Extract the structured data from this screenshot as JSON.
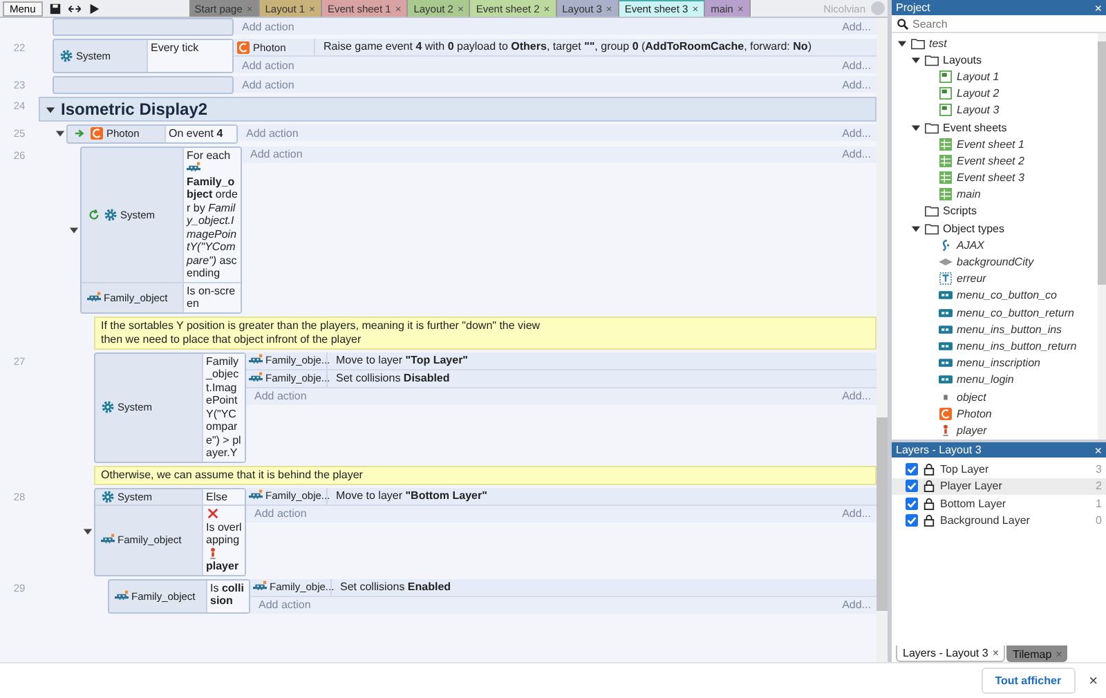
{
  "toolbar": {
    "menu": "Menu",
    "user": "Nicolvian"
  },
  "tabs": [
    {
      "label": "Start page",
      "close": "×",
      "selected": false,
      "color": "#8c8c8c"
    },
    {
      "label": "Layout 1",
      "close": "×",
      "selected": false,
      "color": "#c8b27a"
    },
    {
      "label": "Event sheet 1",
      "close": "×",
      "selected": false,
      "color": "#d9a3a3"
    },
    {
      "label": "Layout 2",
      "close": "×",
      "selected": false,
      "color": "#a9c98f"
    },
    {
      "label": "Event sheet 2",
      "close": "×",
      "selected": false,
      "color": "#bcd99e"
    },
    {
      "label": "Layout 3",
      "close": "×",
      "selected": false,
      "color": "#a9b0c8"
    },
    {
      "label": "Event sheet 3",
      "close": "×",
      "selected": true,
      "color": "#c9f3f5"
    },
    {
      "label": "main",
      "close": "×",
      "selected": false,
      "color": "#b8a0cc"
    }
  ],
  "events": [
    {
      "kind": "event",
      "add_action": "Add action",
      "add_more": "Add..."
    },
    {
      "kind": "event",
      "line": "22",
      "conditions": [
        {
          "object": "System",
          "kind": "system",
          "text": "Every tick"
        }
      ],
      "actions": [
        {
          "object": "Photon",
          "kind": "photon",
          "text": "Raise game event **4** with **0** payload to **Others**, target **\"\"**, group **0** (**AddToRoomCache**, forward: **No**)"
        }
      ],
      "add_action": "Add action",
      "add_more": "Add..."
    },
    {
      "kind": "event",
      "line": "23",
      "add_action": "Add action",
      "add_more": "Add..."
    },
    {
      "kind": "group",
      "line": "24",
      "title": "Isometric Display2",
      "expanded": true,
      "children": [
        {
          "kind": "event",
          "line": "25",
          "expanded": true,
          "conditions": [
            {
              "object": "Photon",
              "kind": "photon",
              "trigger": true,
              "text": "On event **4**"
            }
          ],
          "add_action": "Add action",
          "add_more": "Add...",
          "children": [
            {
              "kind": "event",
              "line": "26",
              "expanded": true,
              "conditions": [
                {
                  "object": "System",
                  "kind": "system",
                  "loop": true,
                  "parts": [
                    {
                      "kind": "text",
                      "text": "For each"
                    },
                    {
                      "kind": "sprite"
                    },
                    {
                      "kind": "text",
                      "text": "**Family_object** order by *Family_object.ImagePointY(\"YCompare\")* ascending"
                    }
                  ]
                },
                {
                  "object": "Family_object",
                  "kind": "sprite",
                  "text": "Is on-screen"
                }
              ],
              "add_action": "Add action",
              "add_more": "Add...",
              "children": [
                {
                  "kind": "comment",
                  "text": "If the sortables Y position is greater than the players, meaning it is further \"down\" the view\nthen we need to place that object infront of the player"
                },
                {
                  "kind": "event",
                  "line": "27",
                  "conditions": [
                    {
                      "object": "System",
                      "kind": "system",
                      "text": "Family_object.ImagePointY(\"YCompare\") > player.Y"
                    }
                  ],
                  "actions": [
                    {
                      "object": "Family_obje...",
                      "kind": "sprite",
                      "text": "Move to layer **\"Top Layer\"**"
                    },
                    {
                      "object": "Family_obje...",
                      "kind": "sprite",
                      "text": "Set collisions **Disabled**"
                    }
                  ],
                  "add_action": "Add action",
                  "add_more": "Add..."
                },
                {
                  "kind": "comment",
                  "text": "Otherwise, we can assume that it is behind the player"
                },
                {
                  "kind": "event",
                  "line": "28",
                  "expanded": true,
                  "conditions": [
                    {
                      "object": "System",
                      "kind": "system",
                      "text": "Else"
                    },
                    {
                      "object": "Family_object",
                      "kind": "sprite",
                      "inverted": true,
                      "parts": [
                        {
                          "kind": "text",
                          "text": "Is overlapping"
                        },
                        {
                          "kind": "player"
                        },
                        {
                          "kind": "text",
                          "text": "**player**"
                        }
                      ]
                    }
                  ],
                  "actions": [
                    {
                      "object": "Family_obje...",
                      "kind": "sprite",
                      "text": "Move to layer **\"Bottom Layer\"**"
                    }
                  ],
                  "add_action": "Add action",
                  "add_more": "Add...",
                  "children": [
                    {
                      "kind": "event",
                      "line": "29",
                      "conditions": [
                        {
                          "object": "Family_object",
                          "kind": "sprite",
                          "text": "Is **collision**"
                        }
                      ],
                      "actions": [
                        {
                          "object": "Family_obje...",
                          "kind": "sprite",
                          "text": "Set collisions **Enabled**"
                        }
                      ],
                      "add_action": "Add action",
                      "add_more": "Add..."
                    }
                  ]
                }
              ]
            }
          ]
        }
      ]
    }
  ],
  "project": {
    "title": "Project",
    "close": "×",
    "search": {
      "placeholder": "Search"
    },
    "tree": [
      {
        "label": "test",
        "kind": "project",
        "expanded": true,
        "children": [
          {
            "label": "Layouts",
            "kind": "folder",
            "expanded": true,
            "children": [
              {
                "label": "Layout 1",
                "kind": "layout"
              },
              {
                "label": "Layout 2",
                "kind": "layout"
              },
              {
                "label": "Layout 3",
                "kind": "layout"
              }
            ]
          },
          {
            "label": "Event sheets",
            "kind": "folder",
            "expanded": true,
            "children": [
              {
                "label": "Event sheet 1",
                "kind": "sheet"
              },
              {
                "label": "Event sheet 2",
                "kind": "sheet"
              },
              {
                "label": "Event sheet 3",
                "kind": "sheet"
              },
              {
                "label": "main",
                "kind": "sheet"
              }
            ]
          },
          {
            "label": "Scripts",
            "kind": "folder"
          },
          {
            "label": "Object types",
            "kind": "folder",
            "expanded": true,
            "children": [
              {
                "label": "AJAX",
                "kind": "ajax"
              },
              {
                "label": "backgroundCity",
                "kind": "tiled"
              },
              {
                "label": "erreur",
                "kind": "text"
              },
              {
                "label": "menu_co_button_co",
                "kind": "button"
              },
              {
                "label": "menu_co_button_return",
                "kind": "button"
              },
              {
                "label": "menu_ins_button_ins",
                "kind": "button"
              },
              {
                "label": "menu_ins_button_return",
                "kind": "button"
              },
              {
                "label": "menu_inscription",
                "kind": "button"
              },
              {
                "label": "menu_login",
                "kind": "button"
              },
              {
                "label": "object",
                "kind": "object"
              },
              {
                "label": "Photon",
                "kind": "photon"
              },
              {
                "label": "player",
                "kind": "player"
              }
            ]
          }
        ]
      }
    ]
  },
  "layers": {
    "title": "Layers - Layout 3",
    "close": "×",
    "items": [
      {
        "name": "Top Layer",
        "number": "3",
        "visible": true,
        "selected": false
      },
      {
        "name": "Player Layer",
        "number": "2",
        "visible": true,
        "selected": true
      },
      {
        "name": "Bottom Layer",
        "number": "1",
        "visible": true,
        "selected": false
      },
      {
        "name": "Background Layer",
        "number": "0",
        "visible": true,
        "selected": false
      }
    ]
  },
  "panel_tabs": [
    {
      "label": "Layers - Layout 3",
      "close": "×",
      "selected": true
    },
    {
      "label": "Tilemap",
      "close": "×",
      "selected": false
    }
  ],
  "notification": {
    "button": "Tout afficher",
    "close": "×"
  }
}
